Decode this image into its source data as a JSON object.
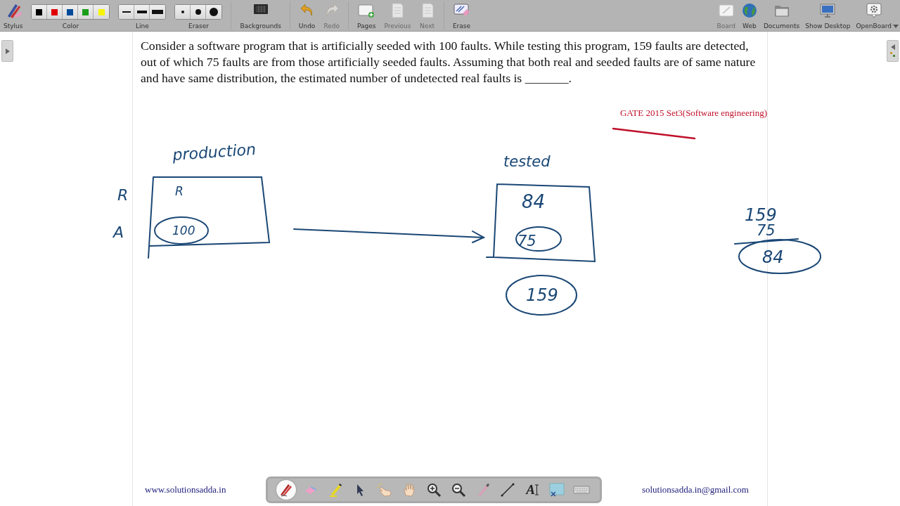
{
  "toolbar": {
    "left": [
      [
        {
          "kind": "stylus",
          "label": "Stylus",
          "disabled": false
        },
        {
          "kind": "colors",
          "label": "Color",
          "swatches": [
            {
              "color": "#000000"
            },
            {
              "color": "#e00000"
            },
            {
              "color": "#004a99"
            },
            {
              "color": "#1a9e1a"
            },
            {
              "color": "#f5f500"
            }
          ]
        },
        {
          "kind": "lines",
          "label": "Line"
        },
        {
          "kind": "erasers",
          "label": "Eraser"
        }
      ],
      [
        {
          "kind": "backgrounds",
          "label": "Backgrounds",
          "disabled": false
        }
      ],
      [
        {
          "kind": "undo",
          "label": "Undo",
          "disabled": false
        },
        {
          "kind": "redo",
          "label": "Redo",
          "disabled": true
        }
      ],
      [
        {
          "kind": "pages",
          "label": "Pages",
          "disabled": false
        },
        {
          "kind": "previous",
          "label": "Previous",
          "disabled": true
        },
        {
          "kind": "next",
          "label": "Next",
          "disabled": true
        }
      ],
      [
        {
          "kind": "erase",
          "label": "Erase",
          "disabled": false
        }
      ]
    ],
    "right": [
      {
        "kind": "board",
        "label": "Board",
        "disabled": true
      },
      {
        "kind": "web",
        "label": "Web",
        "disabled": false
      },
      {
        "kind": "documents",
        "label": "Documents",
        "disabled": false
      },
      {
        "kind": "desktop",
        "label": "Show Desktop",
        "disabled": false
      },
      {
        "kind": "openboard",
        "label": "OpenBoard",
        "disabled": false
      }
    ]
  },
  "page": {
    "question": "Consider a software program that is artificially seeded with 100 faults. While testing this program, 159 faults are detected, out of which 75 faults are from those artificially seeded faults. Assuming that both real and seeded faults are of same nature and have same distribution, the estimated number of undetected real faults is _______.",
    "source": "GATE 2015 Set3(Software engineering)",
    "ink_notes": [
      {
        "text": "production"
      },
      {
        "text": "tested"
      },
      {
        "text": "R"
      },
      {
        "text": "A"
      },
      {
        "text": "R"
      },
      {
        "text": "100"
      },
      {
        "text": "84"
      },
      {
        "text": "75"
      },
      {
        "text": "159"
      },
      {
        "text": "159"
      },
      {
        "text": "75"
      },
      {
        "text": "84"
      }
    ],
    "website": "www.solutionsadda.in",
    "email": "solutionsadda.in@gmail.com"
  },
  "dock": [
    {
      "kind": "pen",
      "selected": true
    },
    {
      "kind": "eraser",
      "selected": false
    },
    {
      "kind": "marker",
      "selected": false
    },
    {
      "kind": "selector",
      "selected": false
    },
    {
      "kind": "interact",
      "selected": false
    },
    {
      "kind": "hand",
      "selected": false
    },
    {
      "kind": "zoom-in",
      "selected": false
    },
    {
      "kind": "zoom-out",
      "selected": false
    },
    {
      "kind": "laser",
      "selected": false
    },
    {
      "kind": "line",
      "selected": false
    },
    {
      "kind": "text",
      "glyph": "A",
      "selected": false
    },
    {
      "kind": "capture",
      "selected": false
    },
    {
      "kind": "keyboard",
      "selected": false
    }
  ]
}
